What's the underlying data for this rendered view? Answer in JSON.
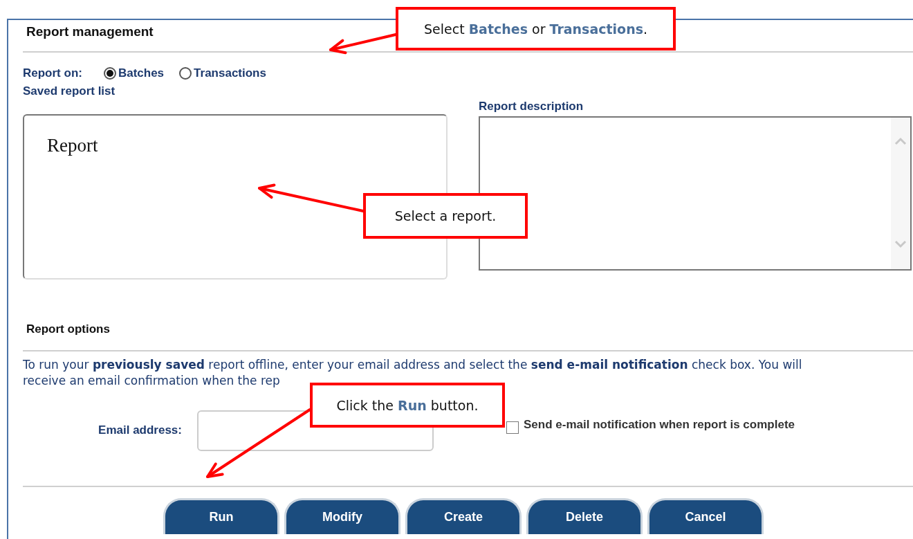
{
  "panel": {
    "title": "Report management",
    "report_on": {
      "label": "Report on:",
      "options": [
        {
          "label": "Batches",
          "selected": true
        },
        {
          "label": "Transactions",
          "selected": false
        }
      ]
    },
    "saved_list": {
      "label": "Saved report list",
      "items": [
        {
          "label": "Report",
          "selected": false
        }
      ]
    },
    "description": {
      "label": "Report description"
    },
    "report_options": {
      "title": "Report options",
      "instructions": "To run your **previously saved** report offline, enter your email address and select the **send e-mail notification** check box. You will receive an email confirmation when the rep",
      "email": {
        "label": "Email address:"
      },
      "notify": {
        "label": "Send e-mail notification when report is complete",
        "checked": false
      }
    },
    "buttons": [
      "Run",
      "Modify",
      "Create",
      "Delete",
      "Cancel"
    ]
  },
  "callouts": [
    {
      "text": "Select **Batches** or **Transactions**."
    },
    {
      "text": "Select a report."
    },
    {
      "text": "Click the **Run** button."
    }
  ]
}
